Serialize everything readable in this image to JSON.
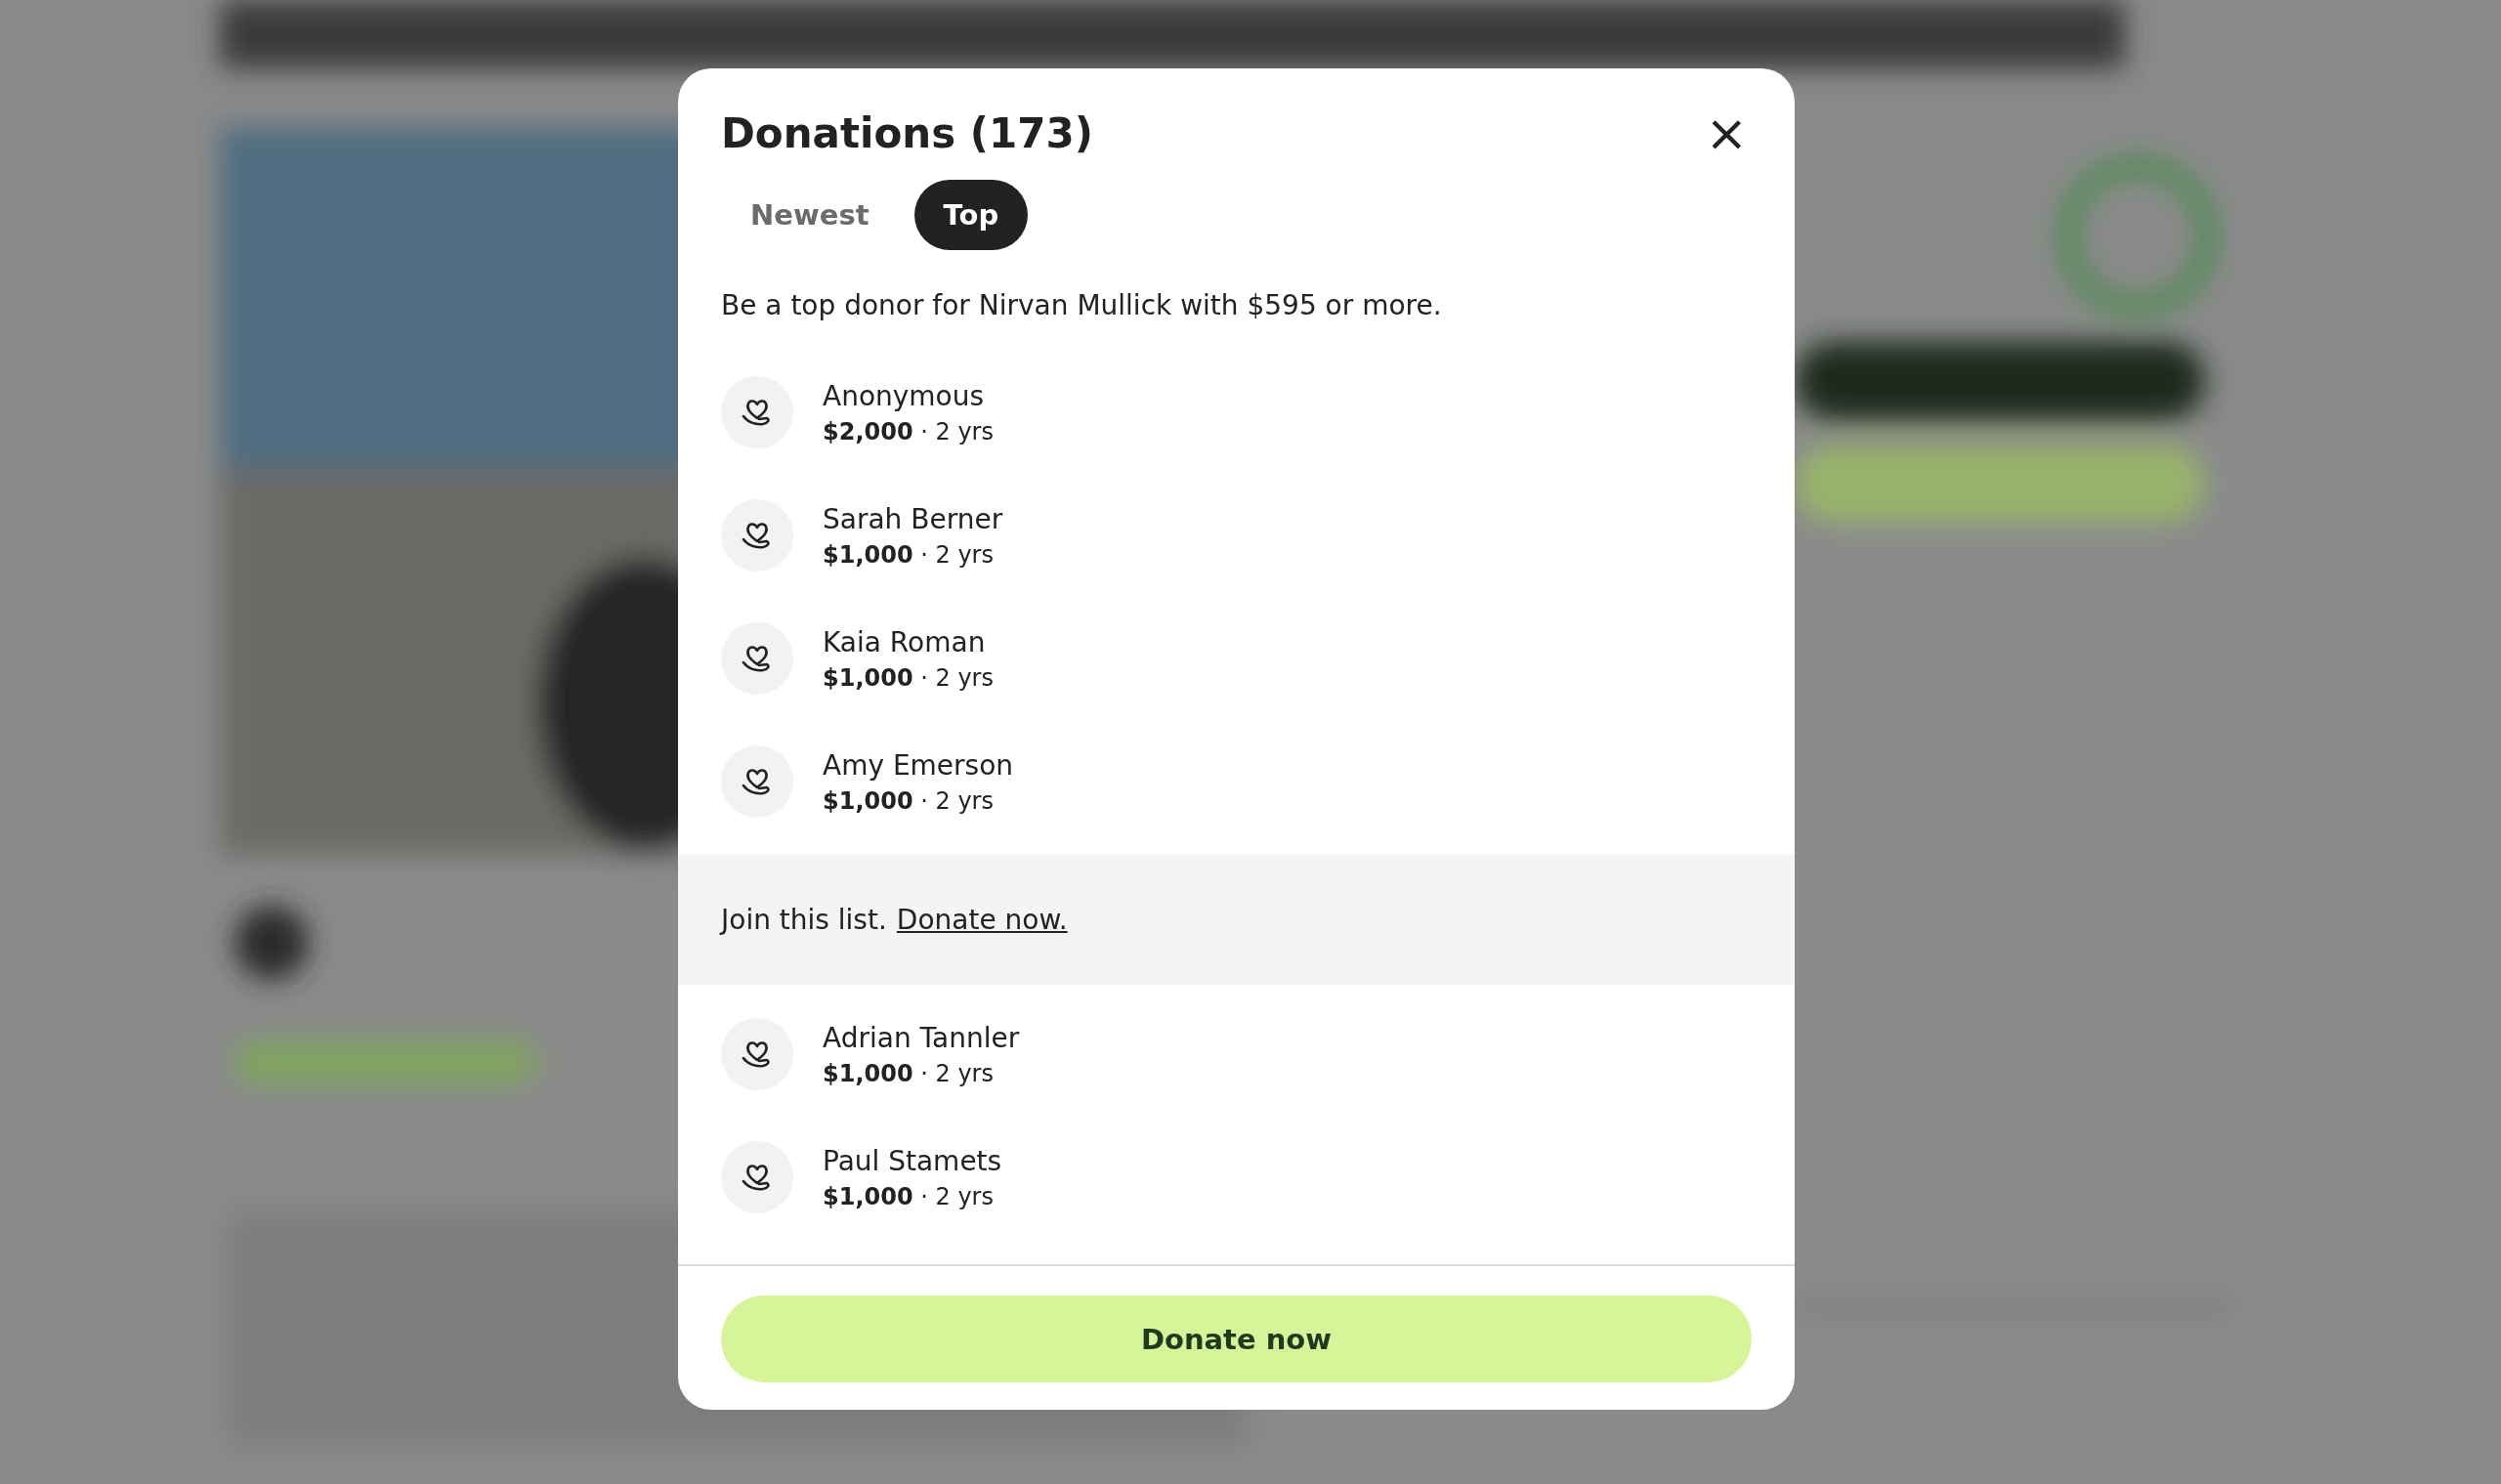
{
  "dialog": {
    "title": "Donations (173)",
    "close": "×"
  },
  "tabs": [
    {
      "label": "Newest",
      "selected": false
    },
    {
      "label": "Top",
      "selected": true
    }
  ],
  "intro": "Be a top donor for Nirvan Mullick with $595 or more.",
  "donations": [
    {
      "name": "Anonymous",
      "detail": "**$2,000** · 2 yrs"
    },
    {
      "name": "Sarah Berner",
      "detail": "**$1,000** · 2 yrs"
    },
    {
      "name": "Kaia Roman",
      "detail": "**$1,000** · 2 yrs"
    },
    {
      "name": "Amy Emerson",
      "detail": "**$1,000** · 2 yrs"
    }
  ],
  "join": {
    "text": "Join this list.",
    "link": "Donate now."
  },
  "more_donations": [
    {
      "name": "Adrian Tannler",
      "detail": "**$1,000** · 2 yrs"
    },
    {
      "name": "Paul Stamets",
      "detail": "**$1,000** · 2 yrs"
    }
  ],
  "donate_button": "Donate now"
}
